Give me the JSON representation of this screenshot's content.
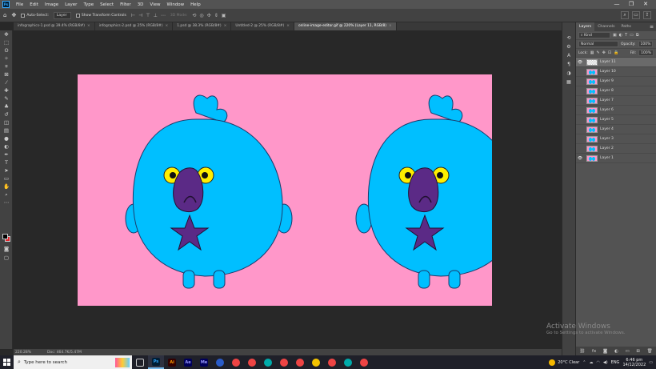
{
  "menubar": {
    "logo": "Ps",
    "items": [
      "File",
      "Edit",
      "Image",
      "Layer",
      "Type",
      "Select",
      "Filter",
      "3D",
      "View",
      "Window",
      "Help"
    ],
    "window_controls": [
      "—",
      "❐",
      "✕"
    ]
  },
  "options": {
    "auto_select_label": "Auto-Select:",
    "auto_select_value": "Layer",
    "transform_controls_label": "Show Transform Controls",
    "mode_3d_label": "3D Mode:"
  },
  "tabs": [
    {
      "label": "infographics-1.psd @ 39.4% (RGB/8#)",
      "active": false
    },
    {
      "label": "infographics-2.psd @ 25% (RGB/8#)",
      "active": false
    },
    {
      "label": "1.psd @ 38.3% (RGB/8#)",
      "active": false
    },
    {
      "label": "Untitled-2 @ 25% (RGB/8#)",
      "active": false
    },
    {
      "label": "online-image-editor.gif @ 220% (Layer 11, RGB/8)",
      "active": true
    }
  ],
  "status": {
    "zoom": "220.28%",
    "doc": "Doc: 464.7K/5.47M"
  },
  "layers_panel": {
    "tabs": [
      "Layers",
      "Channels",
      "Paths"
    ],
    "kind_label": "Kind",
    "blend_mode": "Normal",
    "opacity_label": "Opacity:",
    "opacity_value": "100%",
    "lock_label": "Lock:",
    "fill_label": "Fill:",
    "fill_value": "100%",
    "layers": [
      {
        "name": "Layer 11",
        "visible": true,
        "selected": true,
        "blank": true
      },
      {
        "name": "Layer 10",
        "visible": false,
        "selected": false,
        "blank": false
      },
      {
        "name": "Layer 9",
        "visible": false,
        "selected": false,
        "blank": false
      },
      {
        "name": "Layer 8",
        "visible": false,
        "selected": false,
        "blank": false
      },
      {
        "name": "Layer 7",
        "visible": false,
        "selected": false,
        "blank": false
      },
      {
        "name": "Layer 6",
        "visible": false,
        "selected": false,
        "blank": false
      },
      {
        "name": "Layer 5",
        "visible": false,
        "selected": false,
        "blank": false
      },
      {
        "name": "Layer 4",
        "visible": false,
        "selected": false,
        "blank": false
      },
      {
        "name": "Layer 3",
        "visible": false,
        "selected": false,
        "blank": false
      },
      {
        "name": "Layer 2",
        "visible": false,
        "selected": false,
        "blank": false
      },
      {
        "name": "Layer 1",
        "visible": true,
        "selected": false,
        "blank": false
      }
    ]
  },
  "watermark": {
    "title": "Activate Windows",
    "subtitle": "Go to Settings to activate Windows."
  },
  "taskbar": {
    "search_placeholder": "Type here to search",
    "apps": [
      {
        "label": "Ps",
        "color": "#001e36",
        "fg": "#31a8ff",
        "active": true
      },
      {
        "label": "Ai",
        "color": "#330000",
        "fg": "#ff9a00",
        "active": false
      },
      {
        "label": "Ae",
        "color": "#00005b",
        "fg": "#9999ff",
        "active": false
      },
      {
        "label": "Me",
        "color": "#00005b",
        "fg": "#9999ff",
        "active": false
      },
      {
        "label": "",
        "color": "#2a5cc9",
        "fg": "#fff",
        "active": false
      },
      {
        "label": "",
        "color": "#e44",
        "fg": "#fff",
        "active": false
      },
      {
        "label": "",
        "color": "#e44",
        "fg": "#fff",
        "active": false
      },
      {
        "label": "",
        "color": "#0aa",
        "fg": "#fff",
        "active": false
      },
      {
        "label": "",
        "color": "#e44",
        "fg": "#fff",
        "active": false
      },
      {
        "label": "",
        "color": "#e44",
        "fg": "#fff",
        "active": false
      },
      {
        "label": "",
        "color": "#f5c400",
        "fg": "#333",
        "active": false
      },
      {
        "label": "",
        "color": "#e44",
        "fg": "#fff",
        "active": false
      },
      {
        "label": "",
        "color": "#0aa",
        "fg": "#fff",
        "active": false
      },
      {
        "label": "",
        "color": "#e44",
        "fg": "#fff",
        "active": false
      }
    ],
    "weather": "20°C  Clear",
    "lang": "ENG",
    "time": "6:46 pm",
    "date": "14/12/2022"
  },
  "colors": {
    "canvas_bg": "#ff97c9",
    "character_body": "#00bfff",
    "character_face": "#5b2a86",
    "eye_yellow": "#ffee00"
  }
}
